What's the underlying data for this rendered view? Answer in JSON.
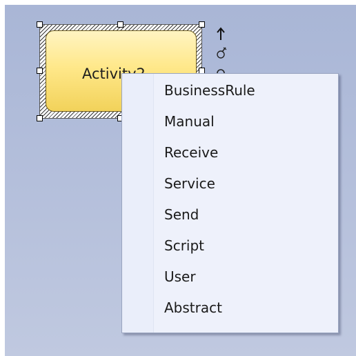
{
  "diagram": {
    "activity": {
      "label": "Activity2",
      "fill_top": "#fff4c2",
      "fill_bottom": "#f2d25a"
    },
    "side_icons": [
      "arrow-up-icon",
      "wrench-icon",
      "gear-icon"
    ]
  },
  "context_menu": {
    "items": [
      {
        "label": "BusinessRule"
      },
      {
        "label": "Manual"
      },
      {
        "label": "Receive"
      },
      {
        "label": "Service"
      },
      {
        "label": "Send"
      },
      {
        "label": "Script"
      },
      {
        "label": "User"
      },
      {
        "label": "Abstract"
      }
    ]
  },
  "colors": {
    "canvas": "#b4bfdb",
    "menu_background": "#eef1fb"
  }
}
